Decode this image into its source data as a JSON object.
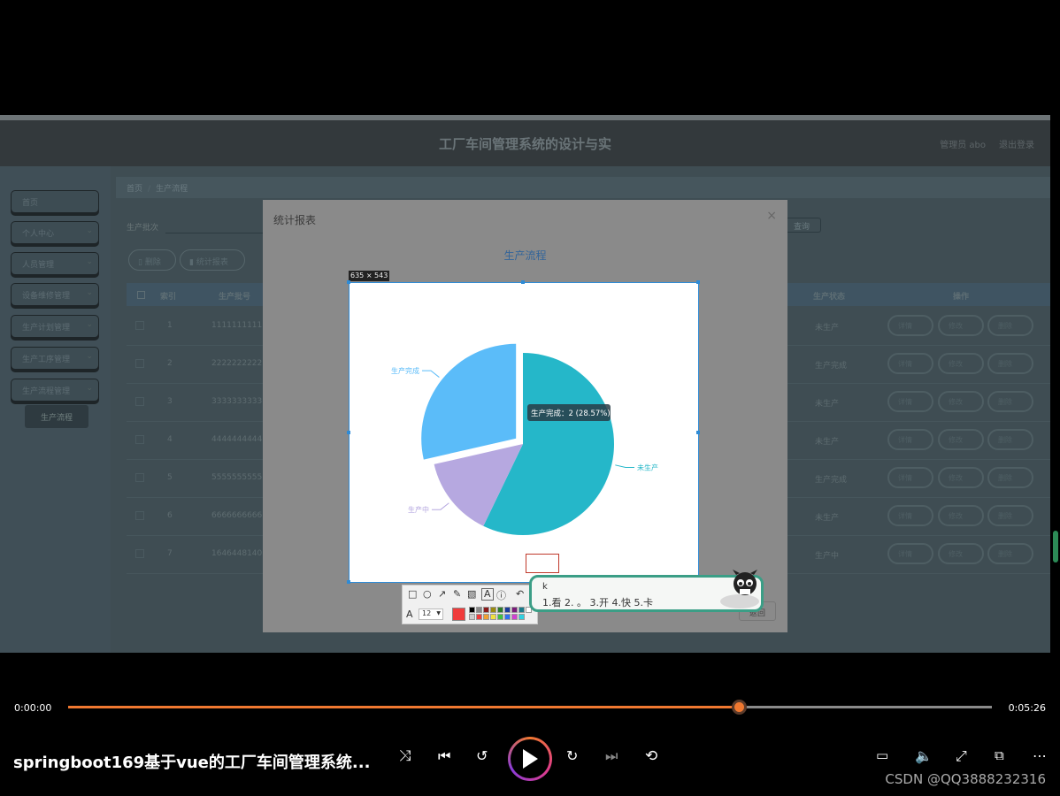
{
  "app": {
    "title": "工厂车间管理系统的设计与实",
    "user": "管理员 abo",
    "logout": "退出登录"
  },
  "sidebar": {
    "items": [
      {
        "label": "首页",
        "has_arrow": false
      },
      {
        "label": "个人中心",
        "has_arrow": true
      },
      {
        "label": "人员管理",
        "has_arrow": true
      },
      {
        "label": "设备维修管理",
        "has_arrow": true
      },
      {
        "label": "生产计划管理",
        "has_arrow": true
      },
      {
        "label": "生产工序管理",
        "has_arrow": true
      },
      {
        "label": "生产流程管理",
        "has_arrow": true
      }
    ],
    "active_sub": "生产流程"
  },
  "breadcrumb": {
    "home": "首页",
    "current": "生产流程"
  },
  "search": {
    "label": "生产批次",
    "query_btn": "查询"
  },
  "actions": {
    "delete": "删除",
    "report": "统计报表"
  },
  "table": {
    "headers": {
      "index": "索引",
      "batch": "生产批号",
      "status": "生产状态",
      "ops": "操作"
    },
    "ops_labels": {
      "view": "详情",
      "edit": "修改",
      "del": "删除"
    },
    "rows": [
      {
        "index": "1",
        "batch": "1111111111",
        "status": "未生产"
      },
      {
        "index": "2",
        "batch": "2222222222",
        "status": "生产完成"
      },
      {
        "index": "3",
        "batch": "3333333333",
        "status": "未生产"
      },
      {
        "index": "4",
        "batch": "4444444444",
        "status": "未生产"
      },
      {
        "index": "5",
        "batch": "5555555555",
        "status": "生产完成"
      },
      {
        "index": "6",
        "batch": "6666666666",
        "status": "未生产"
      },
      {
        "index": "7",
        "batch": "1646448140736",
        "status": "生产中"
      }
    ]
  },
  "modal": {
    "title": "统计报表",
    "close": "×",
    "footer_btn": "返回"
  },
  "chart_data": {
    "type": "pie",
    "title": "生产流程",
    "slices": [
      {
        "label": "未生产",
        "value": 4,
        "color": "#25b7c9"
      },
      {
        "label": "生产中",
        "value": 1,
        "color": "#b6a8e0"
      },
      {
        "label": "生产完成",
        "value": 2,
        "color": "#5bbcf9"
      }
    ],
    "tooltip": "生产完成：2 (28.57%)"
  },
  "capture": {
    "size": "635 × 543",
    "font_size": "12",
    "active_color": "#f03c3c"
  },
  "ime": {
    "composition": "k",
    "candidates": "1.看  2.  。  3.开  4.快  5.卡"
  },
  "player": {
    "current_time": "0:00:00",
    "total_time": "0:05:26",
    "progress": 0.726,
    "video_title": "springboot169基于vue的工厂车间管理系统...",
    "accent": "#f07830"
  },
  "watermark": "CSDN @QQ3888232316"
}
